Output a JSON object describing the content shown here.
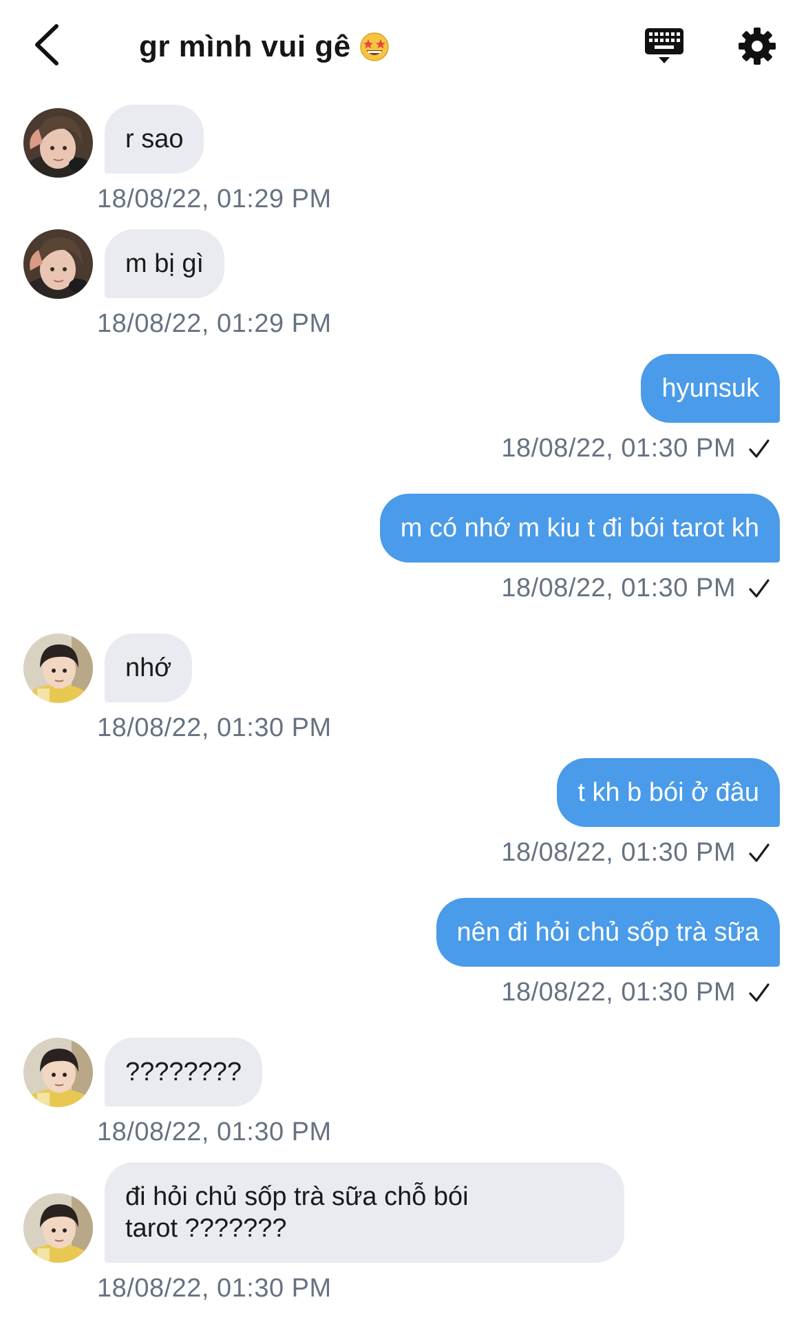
{
  "header": {
    "title": "gr mình vui gê",
    "title_emoji": "star-struck-emoji"
  },
  "colors": {
    "outgoing_bubble": "#4a9be9",
    "incoming_bubble": "#e9ebf0",
    "timestamp": "#667281",
    "title": "#161616"
  },
  "messages": [
    {
      "side": "in",
      "text": "r sao",
      "time": "18/08/22, 01:29 PM",
      "avatar": "avatar-user-1"
    },
    {
      "side": "in",
      "text": "m bị gì",
      "time": "18/08/22, 01:29 PM",
      "avatar": "avatar-user-1"
    },
    {
      "side": "out",
      "text": "hyunsuk",
      "time": "18/08/22, 01:30 PM"
    },
    {
      "side": "out",
      "text": "m có nhớ m kiu t đi bói tarot kh",
      "time": "18/08/22, 01:30 PM"
    },
    {
      "side": "in",
      "text": "nhớ",
      "time": "18/08/22, 01:30 PM",
      "avatar": "avatar-user-2"
    },
    {
      "side": "out",
      "text": "t kh b bói ở đâu",
      "time": "18/08/22, 01:30 PM"
    },
    {
      "side": "out",
      "text": "nên đi hỏi chủ sốp trà sữa",
      "time": "18/08/22, 01:30 PM"
    },
    {
      "side": "in",
      "text": "????????",
      "time": "18/08/22, 01:30 PM",
      "avatar": "avatar-user-2"
    },
    {
      "side": "in",
      "text_line1": "đi hỏi chủ sốp trà sữa chỗ bói",
      "text_line2": "tarot ???????",
      "time": "18/08/22, 01:30 PM",
      "avatar": "avatar-user-2"
    }
  ]
}
